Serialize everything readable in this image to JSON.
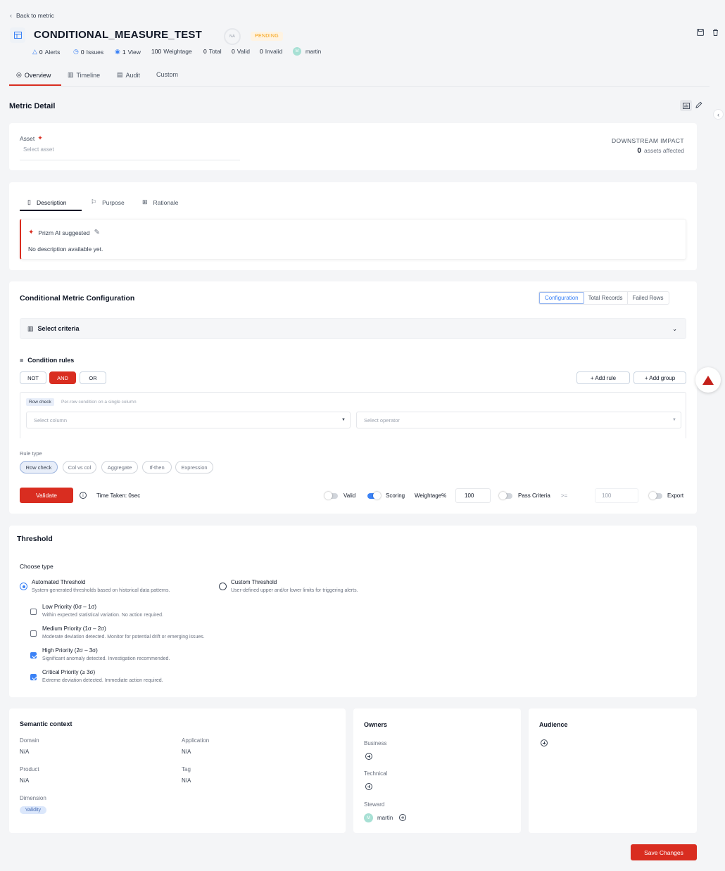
{
  "header": {
    "back_label": "Back to metric",
    "title": "CONDITIONAL_MEASURE_TEST",
    "score_badge": "NA",
    "status_badge": "PENDING",
    "stats": {
      "alerts_count": "0",
      "alerts_label": "Alerts",
      "issues_count": "0",
      "issues_label": "Issues",
      "views_count": "1",
      "views_label": "View",
      "weightage_count": "100",
      "weightage_label": "Weightage",
      "total_count": "0",
      "total_label": "Total",
      "valid_count": "0",
      "valid_label": "Valid",
      "invalid_count": "0",
      "invalid_label": "Invalid"
    },
    "user_initial": "M",
    "user_name": "martin"
  },
  "tabs": [
    {
      "label": "Overview",
      "active": true
    },
    {
      "label": "Timeline"
    },
    {
      "label": "Audit"
    },
    {
      "label": "Custom"
    }
  ],
  "metric_detail": {
    "title": "Metric Detail",
    "asset_label": "Asset",
    "asset_placeholder": "Select asset",
    "downstream_title": "DOWNSTREAM IMPACT",
    "downstream_count": "0",
    "downstream_suffix": "assets affected"
  },
  "description": {
    "tabs": [
      "Description",
      "Purpose",
      "Rationale"
    ],
    "ai_label": "Prizm AI suggested",
    "text": "No description available yet."
  },
  "config": {
    "title": "Conditional Metric Configuration",
    "view_tabs": [
      "Configuration",
      "Total Records",
      "Failed Rows"
    ],
    "criteria_label": "Select criteria",
    "condition_rules_label": "Condition rules",
    "logic_buttons": [
      "NOT",
      "AND",
      "OR"
    ],
    "add_rule": "+ Add rule",
    "add_group": "+ Add group",
    "row_check_badge": "Row check",
    "row_check_hint": "Per-row condition on a single column",
    "column_placeholder": "Select column",
    "operator_placeholder": "Select operator",
    "rule_type_label": "Rule type",
    "rule_types": [
      "Row check",
      "Col vs col",
      "Aggregate",
      "If-then",
      "Expression"
    ],
    "validate_label": "Validate",
    "time_taken": "Time Taken: 0sec",
    "valid_label": "Valid",
    "scoring_label": "Scoring",
    "weightage_label": "Weightage%",
    "weightage_value": "100",
    "pass_criteria_label": "Pass Criteria",
    "pass_operator": ">=",
    "pass_value": "100",
    "export_label": "Export"
  },
  "threshold": {
    "title": "Threshold",
    "choose_type": "Choose type",
    "automated_title": "Automated Threshold",
    "automated_desc": "System-generated thresholds based on historical data patterns.",
    "custom_title": "Custom Threshold",
    "custom_desc": "User-defined upper and/or lower limits for triggering alerts.",
    "priorities": [
      {
        "title": "Low Priority (0σ – 1σ)",
        "desc": "Within expected statistical variation. No action required.",
        "checked": false
      },
      {
        "title": "Medium Priority (1σ – 2σ)",
        "desc": "Moderate deviation detected. Monitor for potential drift or emerging issues.",
        "checked": false
      },
      {
        "title": "High Priority (2σ – 3σ)",
        "desc": "Significant anomaly detected. Investigation recommended.",
        "checked": true
      },
      {
        "title": "Critical Priority (≥ 3σ)",
        "desc": "Extreme deviation detected. Immediate action required.",
        "checked": true
      }
    ]
  },
  "semantic": {
    "title": "Semantic context",
    "domain_label": "Domain",
    "domain_value": "N/A",
    "application_label": "Application",
    "application_value": "N/A",
    "product_label": "Product",
    "product_value": "N/A",
    "tag_label": "Tag",
    "tag_value": "N/A",
    "dimension_label": "Dimension",
    "dimension_value": "Validity"
  },
  "owners": {
    "title": "Owners",
    "business_label": "Business",
    "technical_label": "Technical",
    "steward_label": "Steward",
    "steward_initial": "M",
    "steward_name": "martin"
  },
  "audience": {
    "title": "Audience"
  },
  "save_label": "Save Changes",
  "colors": {
    "accent_red": "#d92d20",
    "accent_blue": "#3b82f6",
    "pending": "#f59e0b"
  }
}
